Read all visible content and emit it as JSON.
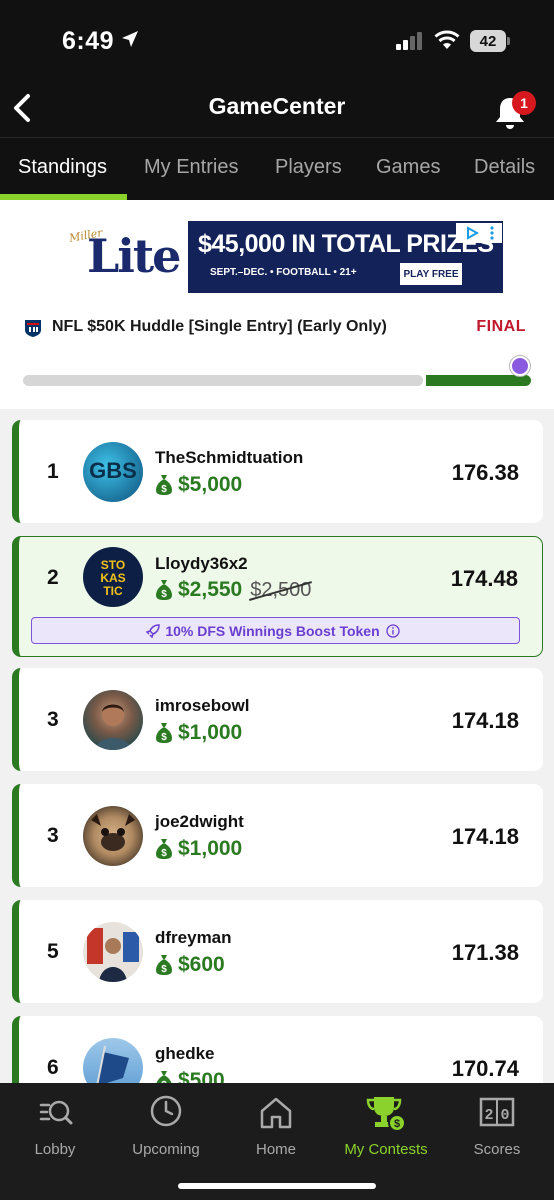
{
  "status_bar": {
    "time": "6:49",
    "battery": "42"
  },
  "header": {
    "title": "GameCenter",
    "notification_count": "1"
  },
  "tabs": [
    {
      "label": "Standings",
      "active": true
    },
    {
      "label": "My Entries",
      "active": false
    },
    {
      "label": "Players",
      "active": false
    },
    {
      "label": "Games",
      "active": false
    },
    {
      "label": "Details",
      "active": false
    }
  ],
  "ad": {
    "brand_small": "Miller",
    "brand": "Lite",
    "headline": "$45,000 IN TOTAL PRIZES",
    "subline": "SEPT.–DEC. • FOOTBALL • 21+",
    "cta": "PLAY FREE"
  },
  "contest": {
    "name": "NFL $50K Huddle [Single Entry] (Early Only)",
    "status": "FINAL",
    "progress": 1.0
  },
  "standings": [
    {
      "rank": "1",
      "username": "TheSchmidtuation",
      "prize": "$5,000",
      "score": "176.38",
      "avatar_text": "GBS"
    },
    {
      "rank": "2",
      "username": "Lloydy36x2",
      "prize": "$2,550",
      "prize_original": "$2,500",
      "score": "174.48",
      "avatar_text": "STO KAS TIC",
      "boost": "10% DFS Winnings Boost Token",
      "highlighted": true
    },
    {
      "rank": "3",
      "username": "imrosebowl",
      "prize": "$1,000",
      "score": "174.18"
    },
    {
      "rank": "3",
      "username": "joe2dwight",
      "prize": "$1,000",
      "score": "174.18"
    },
    {
      "rank": "5",
      "username": "dfreyman",
      "prize": "$600",
      "score": "171.38"
    },
    {
      "rank": "6",
      "username": "ghedke",
      "prize": "$500",
      "score": "170.74"
    }
  ],
  "bottom_nav": [
    {
      "label": "Lobby",
      "icon": "lobby-search-icon"
    },
    {
      "label": "Upcoming",
      "icon": "clock-icon"
    },
    {
      "label": "Home",
      "icon": "home-icon"
    },
    {
      "label": "My Contests",
      "icon": "trophy-icon",
      "active": true
    },
    {
      "label": "Scores",
      "icon": "scoreboard-icon"
    }
  ],
  "colors": {
    "accent": "#8bd32c",
    "prize_green": "#2b7a22",
    "final_red": "#c0182d",
    "boost_purple": "#6a3fcf"
  }
}
